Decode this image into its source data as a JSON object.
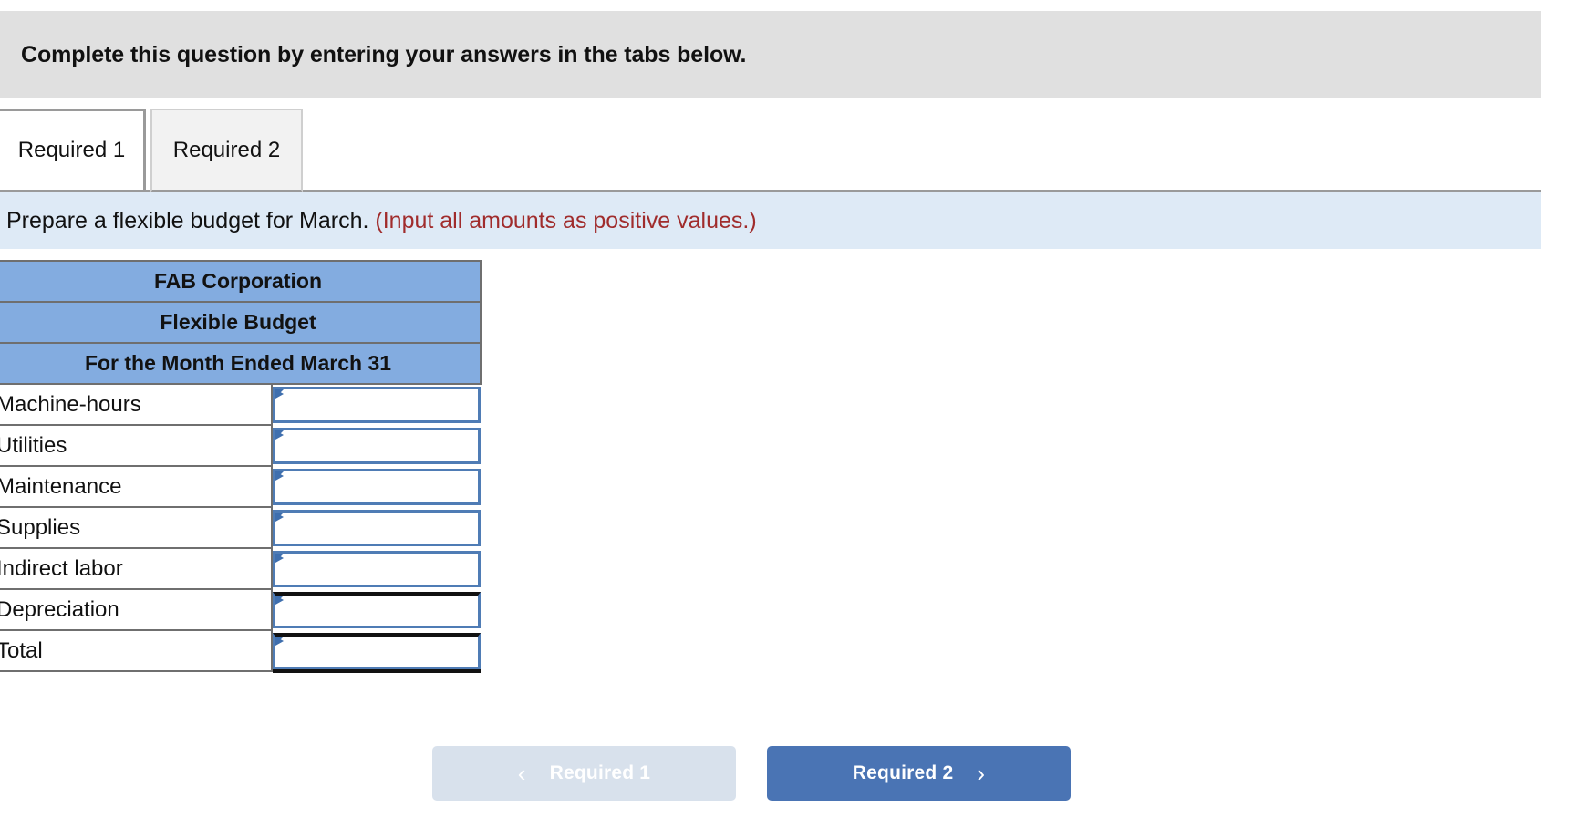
{
  "banner": {
    "text": "Complete this question by entering your answers in the tabs below."
  },
  "tabs": [
    {
      "label": "Required 1",
      "active": true
    },
    {
      "label": "Required 2",
      "active": false
    }
  ],
  "instruction": {
    "main": "Prepare a flexible budget for March.",
    "note": "(Input all amounts as positive values.)"
  },
  "worksheet": {
    "title_rows": [
      "FAB Corporation",
      "Flexible Budget",
      "For the Month Ended March 31"
    ],
    "rows": [
      {
        "label": "Machine-hours",
        "value": ""
      },
      {
        "label": "Utilities",
        "value": ""
      },
      {
        "label": "Maintenance",
        "value": ""
      },
      {
        "label": "Supplies",
        "value": ""
      },
      {
        "label": "Indirect labor",
        "value": ""
      },
      {
        "label": "Depreciation",
        "value": ""
      },
      {
        "label": "Total",
        "value": ""
      }
    ]
  },
  "nav": {
    "prev_label": "Required 1",
    "prev_icon": "chevron-left-icon",
    "prev_glyph": "‹",
    "next_label": "Required 2",
    "next_icon": "chevron-right-icon",
    "next_glyph": "›"
  },
  "colors": {
    "banner_bg": "#e0e0e0",
    "instruction_bg": "#deeaf6",
    "instruction_note": "#a02c2c",
    "table_header_bg": "#83ace0",
    "input_border": "#4f7cb5",
    "btn_active_bg": "#4a74b4",
    "btn_disabled_bg": "#d8e1ec"
  }
}
